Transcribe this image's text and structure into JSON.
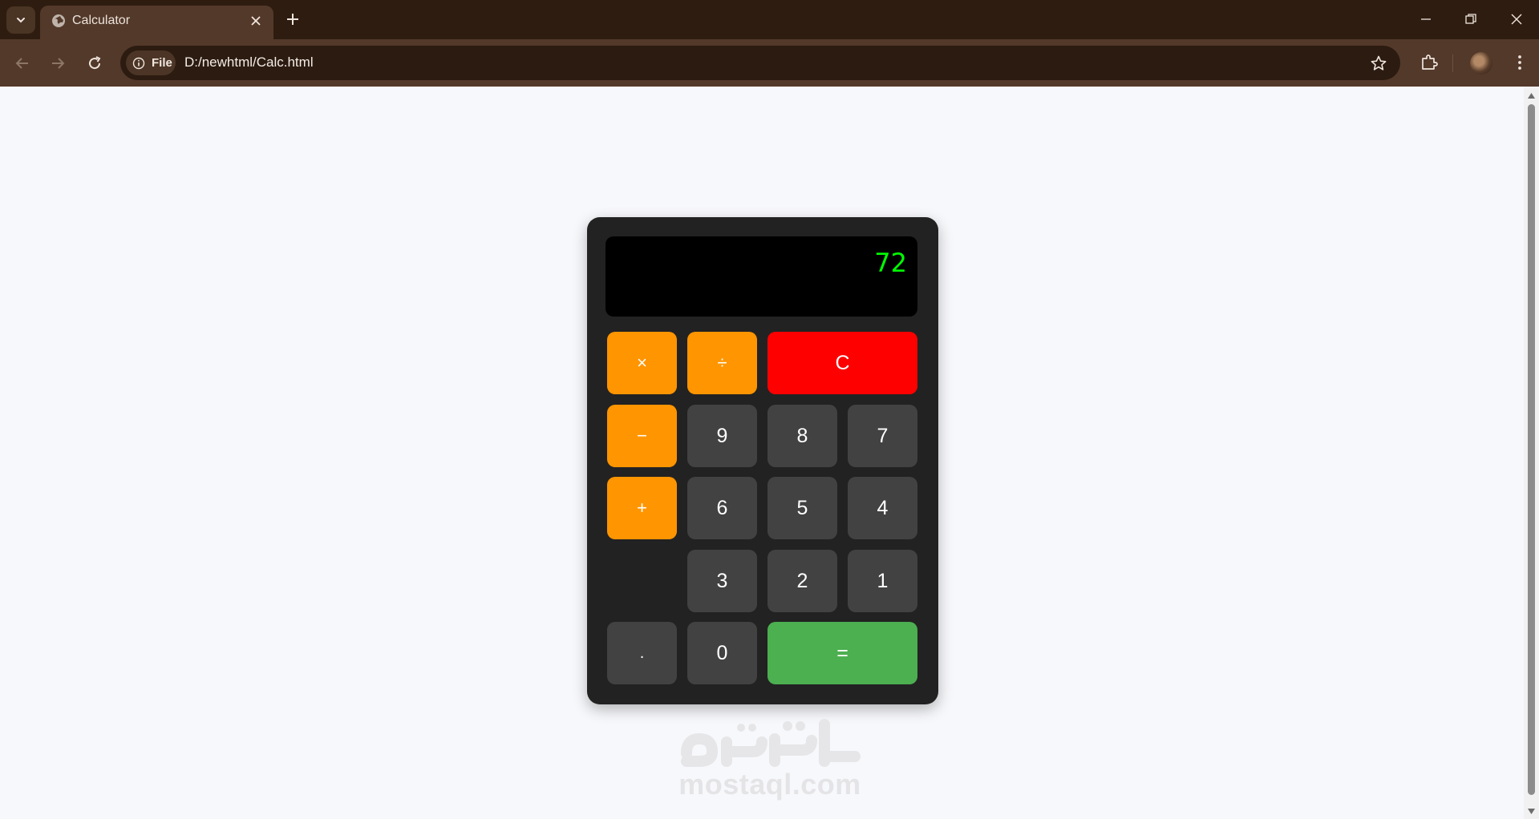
{
  "browser": {
    "tab_title": "Calculator",
    "chip_label": "File",
    "url": "D:/newhtml/Calc.html"
  },
  "calculator": {
    "display_value": "72",
    "keys": {
      "multiply": "×",
      "divide": "÷",
      "clear": "C",
      "minus": "−",
      "nine": "9",
      "eight": "8",
      "seven": "7",
      "plus": "+",
      "six": "6",
      "five": "5",
      "four": "4",
      "three": "3",
      "two": "2",
      "one": "1",
      "decimal": ".",
      "zero": "0",
      "equals": "="
    },
    "colors": {
      "operator": "#ff9500",
      "clear": "#ff0000",
      "equals": "#4caf50",
      "digit": "#424242",
      "display_text": "#00ff00"
    }
  },
  "watermark": {
    "arabic": "مستقل",
    "latin": "mostaql.com"
  }
}
